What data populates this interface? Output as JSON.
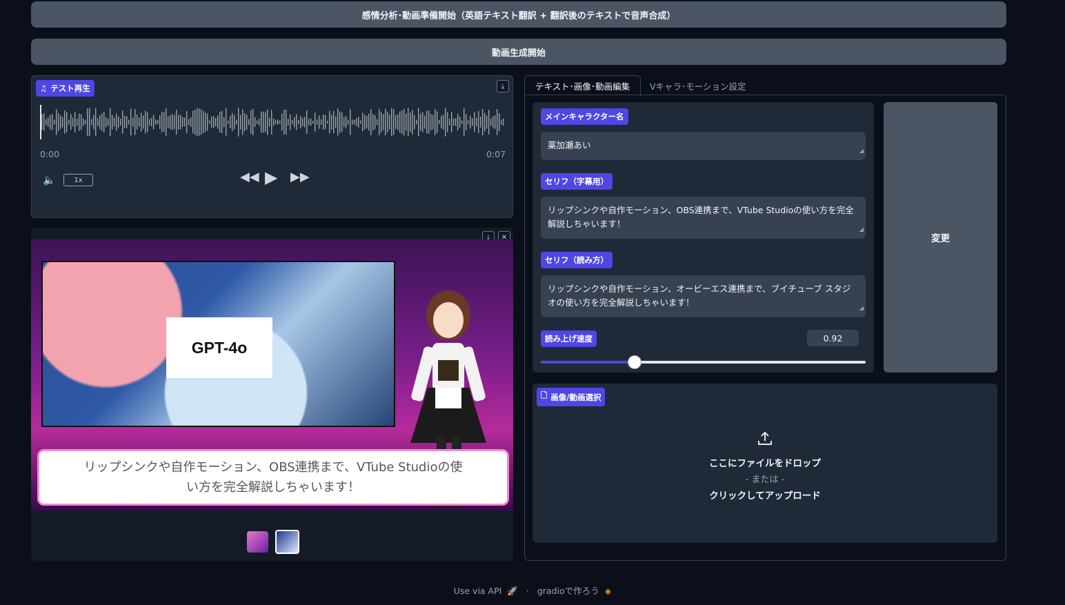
{
  "buttons": {
    "analysis": "感情分析･動画準備開始（英語テキスト翻訳 + 翻訳後のテキストで音声合成）",
    "video": "動画生成開始",
    "change": "変更"
  },
  "audio": {
    "label": "テスト再生",
    "time_start": "0:00",
    "time_end": "0:07",
    "speed": "1x",
    "icons": {
      "label": "music-note-icon",
      "volume": "volume-icon",
      "download": "download-icon"
    }
  },
  "viewer": {
    "slide_text": "GPT-4o",
    "subtitle": "リップシンクや自作モーション、OBS連携まで、VTube Studioの使い方を完全解説しちゃいます！"
  },
  "tabs": [
    {
      "label": "テキスト･画像･動画編集",
      "active": true
    },
    {
      "label": "Vキャラ･モーション設定",
      "active": false
    }
  ],
  "form": {
    "character_label": "メインキャラクター名",
    "character_value": "薬加瀬あい",
    "serif_label": "セリフ（字幕用）",
    "serif_value": "リップシンクや自作モーション、OBS連携まで、VTube Studioの使い方を完全解説しちゃいます！",
    "reading_label": "セリフ（読み方）",
    "reading_value": "リップシンクや自作モーション、オービーエス連携まで、ブイチューブ スタジオの使い方を完全解説しちゃいます！",
    "speed_label": "読み上げ速度",
    "speed_value": "0.92",
    "speed_fraction": 0.288
  },
  "upload": {
    "label": "画像/動画選択",
    "drop": "ここにファイルをドロップ",
    "or": "- または -",
    "click": "クリックしてアップロード"
  },
  "footer": {
    "api": "Use via API",
    "sep": "·",
    "gradio": "gradioで作ろう"
  },
  "colors": {
    "accent": "#4f46e5",
    "button": "#4b5563",
    "panel": "#1f2937",
    "background": "#0b0f19"
  }
}
